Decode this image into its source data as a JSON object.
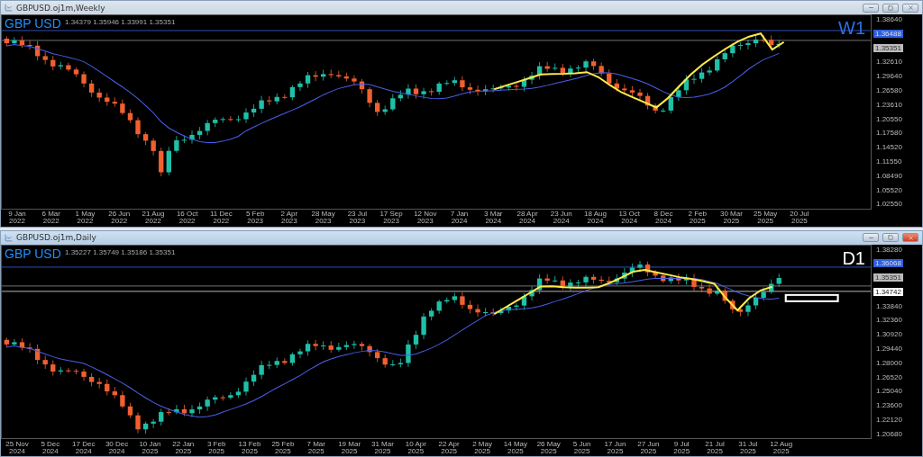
{
  "windows": [
    {
      "title": "GBPUSD.oj1m,Weekly",
      "active": false,
      "symbol": "GBP USD",
      "timeframe": "W1",
      "color": "#2f6fe0",
      "ohlc": "1.34379 1.35946 1.33991 1.35351",
      "price_axis": [
        {
          "label": "1.38640",
          "kind": "tick"
        },
        {
          "label": "1.36488",
          "kind": "level"
        },
        {
          "label": "1.35351",
          "kind": "price"
        },
        {
          "label": "1.32610",
          "kind": "tick"
        },
        {
          "label": "1.29640",
          "kind": "tick"
        },
        {
          "label": "1.26580",
          "kind": "tick"
        },
        {
          "label": "1.23610",
          "kind": "tick"
        },
        {
          "label": "1.20550",
          "kind": "tick"
        },
        {
          "label": "1.17580",
          "kind": "tick"
        },
        {
          "label": "1.14520",
          "kind": "tick"
        },
        {
          "label": "1.11550",
          "kind": "tick"
        },
        {
          "label": "1.08490",
          "kind": "tick"
        },
        {
          "label": "1.05520",
          "kind": "tick"
        },
        {
          "label": "1.02550",
          "kind": "tick"
        }
      ],
      "time_axis": [
        "9 Jan 2022",
        "6 Mar 2022",
        "1 May 2022",
        "26 Jun 2022",
        "21 Aug 2022",
        "16 Oct 2022",
        "11 Dec 2022",
        "5 Feb 2023",
        "2 Apr 2023",
        "28 May 2023",
        "23 Jul 2023",
        "17 Sep 2023",
        "12 Nov 2023",
        "7 Jan 2024",
        "3 Mar 2024",
        "28 Apr 2024",
        "23 Jun 2024",
        "18 Aug 2024",
        "13 Oct 2024",
        "8 Dec 2024",
        "2 Feb 2025",
        "30 Mar 2025",
        "25 May 2025",
        "20 Jul 2025"
      ]
    },
    {
      "title": "GBPUSD.oj1m,Daily",
      "active": true,
      "symbol": "GBP USD",
      "timeframe": "D1",
      "color": "#ffffff",
      "ohlc": "1.35227 1.35749 1.35186 1.35351",
      "price_axis": [
        {
          "label": "1.38280",
          "kind": "tick"
        },
        {
          "label": "1.36068",
          "kind": "level"
        },
        {
          "label": "1.35351",
          "kind": "price"
        },
        {
          "label": "1.34742",
          "kind": "line"
        },
        {
          "label": "1.33840",
          "kind": "tick"
        },
        {
          "label": "1.32360",
          "kind": "tick"
        },
        {
          "label": "1.30920",
          "kind": "tick"
        },
        {
          "label": "1.29440",
          "kind": "tick"
        },
        {
          "label": "1.28000",
          "kind": "tick"
        },
        {
          "label": "1.26520",
          "kind": "tick"
        },
        {
          "label": "1.25040",
          "kind": "tick"
        },
        {
          "label": "1.23600",
          "kind": "tick"
        },
        {
          "label": "1.22120",
          "kind": "tick"
        },
        {
          "label": "1.20680",
          "kind": "tick"
        }
      ],
      "time_axis": [
        "25 Nov 2024",
        "5 Dec 2024",
        "17 Dec 2024",
        "30 Dec 2024",
        "10 Jan 2025",
        "22 Jan 2025",
        "3 Feb 2025",
        "13 Feb 2025",
        "25 Feb 2025",
        "7 Mar 2025",
        "19 Mar 2025",
        "31 Mar 2025",
        "10 Apr 2025",
        "22 Apr 2025",
        "2 May 2025",
        "14 May 2025",
        "26 May 2025",
        "5 Jun 2025",
        "17 Jun 2025",
        "27 Jun 2025",
        "9 Jul 2025",
        "21 Jul 2025",
        "31 Jul 2025",
        "12 Aug 2025"
      ]
    }
  ]
}
